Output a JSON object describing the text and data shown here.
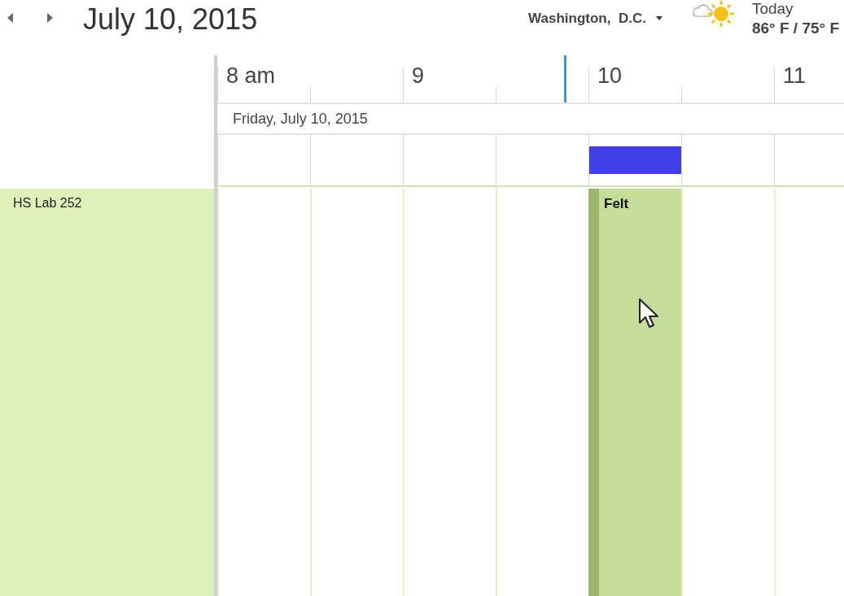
{
  "header": {
    "date_title": "July 10, 2015",
    "location": "Washington,  D.C.",
    "weather": {
      "label": "Today",
      "temps": "86° F / 75° F"
    }
  },
  "timeline": {
    "hours": [
      "8 am",
      "9",
      "10",
      "11"
    ],
    "day_label": "Friday, July 10, 2015",
    "slots": [
      {
        "now": false,
        "busy": false
      },
      {
        "now": false,
        "busy": false
      },
      {
        "now": false,
        "busy": false
      },
      {
        "now": true,
        "busy": false
      },
      {
        "now": false,
        "busy": true
      },
      {
        "now": false,
        "busy": false
      },
      {
        "now": false,
        "busy": false
      }
    ]
  },
  "resources": [
    {
      "name": "HS Lab 252",
      "cells": [
        {
          "booked": false
        },
        {
          "booked": false
        },
        {
          "booked": false
        },
        {
          "booked": false
        },
        {
          "booked": true,
          "title": "Felt"
        },
        {
          "booked": false
        },
        {
          "booked": false
        }
      ]
    }
  ]
}
